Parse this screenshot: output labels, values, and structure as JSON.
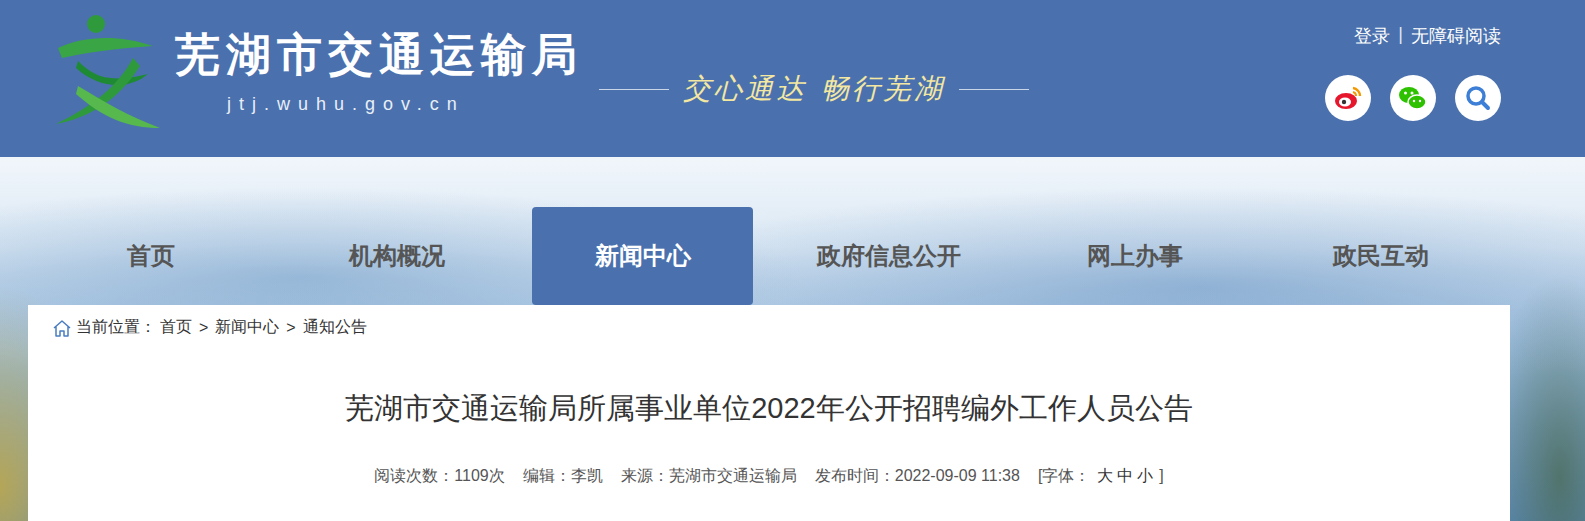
{
  "header": {
    "title": "芜湖市交通运输局",
    "domain": "jtj.wuhu.gov.cn",
    "slogan": [
      "交心通达",
      "畅行芜湖"
    ],
    "links": [
      "登录",
      "无障碍阅读"
    ],
    "separator": "|"
  },
  "nav": [
    {
      "label": "首页",
      "selected": false
    },
    {
      "label": "机构概况",
      "selected": false
    },
    {
      "label": "新闻中心",
      "selected": true
    },
    {
      "label": "政府信息公开",
      "selected": false
    },
    {
      "label": "网上办事",
      "selected": false
    },
    {
      "label": "政民互动",
      "selected": false
    }
  ],
  "breadcrumb": {
    "prefix": "当前位置：",
    "items": [
      "首页",
      "新闻中心",
      "通知公告"
    ],
    "separator": ">"
  },
  "article": {
    "title": "芜湖市交通运输局所属事业单位2022年公开招聘编外工作人员公告",
    "meta": [
      {
        "label": "阅读次数：",
        "value": "1109次"
      },
      {
        "label": "编辑：",
        "value": "李凯"
      },
      {
        "label": "来源：",
        "value": "芜湖市交通运输局"
      },
      {
        "label": "发布时间：",
        "value": "2022-09-09 11:38"
      }
    ],
    "font_size": {
      "open": "[字体：",
      "options": [
        "大",
        "中",
        "小"
      ],
      "close": "]"
    }
  }
}
